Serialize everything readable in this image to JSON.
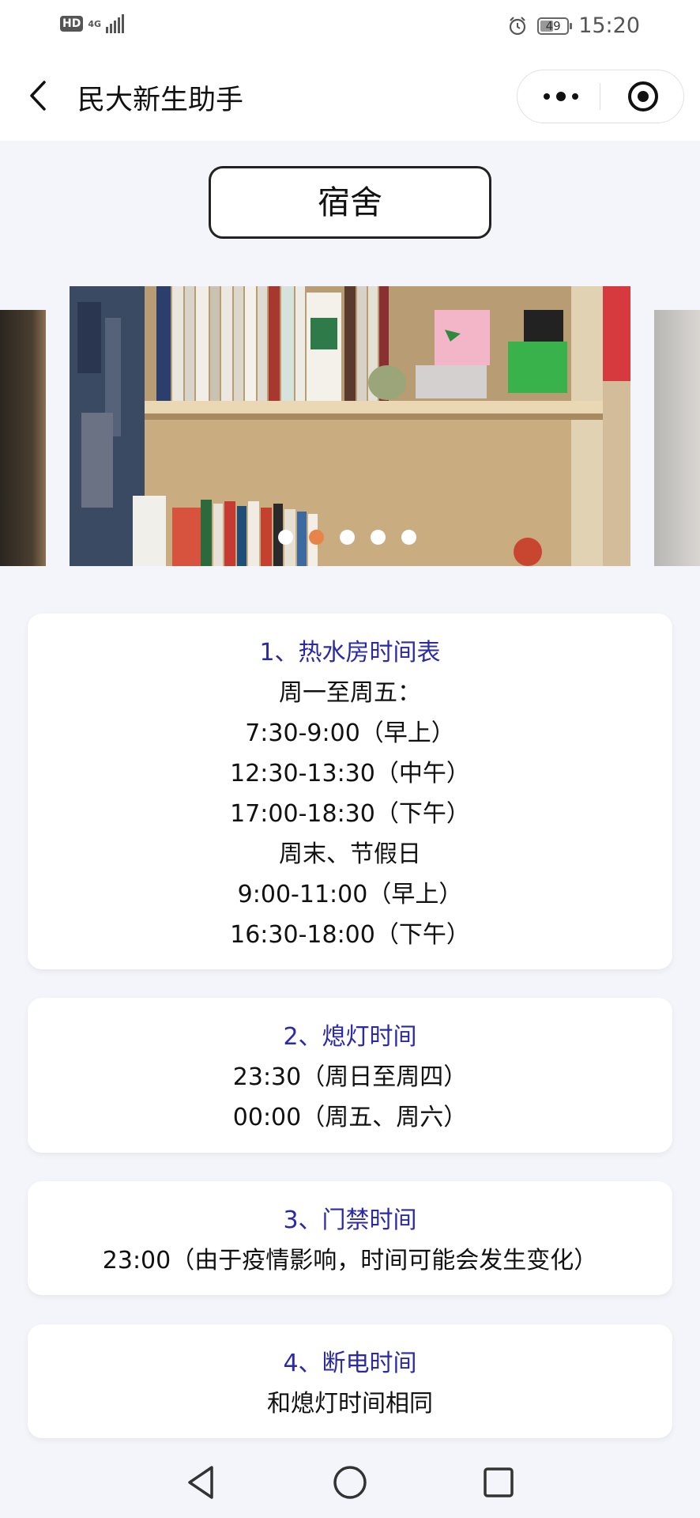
{
  "status_bar": {
    "hd_label": "HD",
    "network_label": "4G",
    "battery_level": "49",
    "time": "15:20",
    "icons": [
      "signal-bars-icon",
      "alarm-clock-icon",
      "battery-icon"
    ]
  },
  "nav": {
    "title": "民大新生助手",
    "back_icon": "chevron-left-icon",
    "more_icon": "more-dots-icon",
    "close_icon": "target-circle-icon"
  },
  "section_title": "宿舍",
  "carousel": {
    "slide_count": 5,
    "active_index": 1
  },
  "cards": [
    {
      "title": "1、热水房时间表",
      "lines": [
        "周一至周五：",
        "7:30-9:00（早上）",
        "12:30-13:30（中午）",
        "17:00-18:30（下午）",
        "周末、节假日",
        "9:00-11:00（早上）",
        "16:30-18:00（下午）"
      ]
    },
    {
      "title": "2、熄灯时间",
      "lines": [
        "23:30（周日至周四）",
        "00:00（周五、周六）"
      ]
    },
    {
      "title": "3、门禁时间",
      "lines": [
        "23:00（由于疫情影响，时间可能会发生变化）"
      ]
    },
    {
      "title": "4、断电时间",
      "lines": [
        "和熄灯时间相同"
      ]
    }
  ],
  "colors": {
    "accent_title": "#2a2aa8",
    "active_dot": "#e8834a",
    "background": "#f4f5fa"
  },
  "bottom_nav": [
    "back-triangle-icon",
    "home-circle-icon",
    "recents-square-icon"
  ]
}
